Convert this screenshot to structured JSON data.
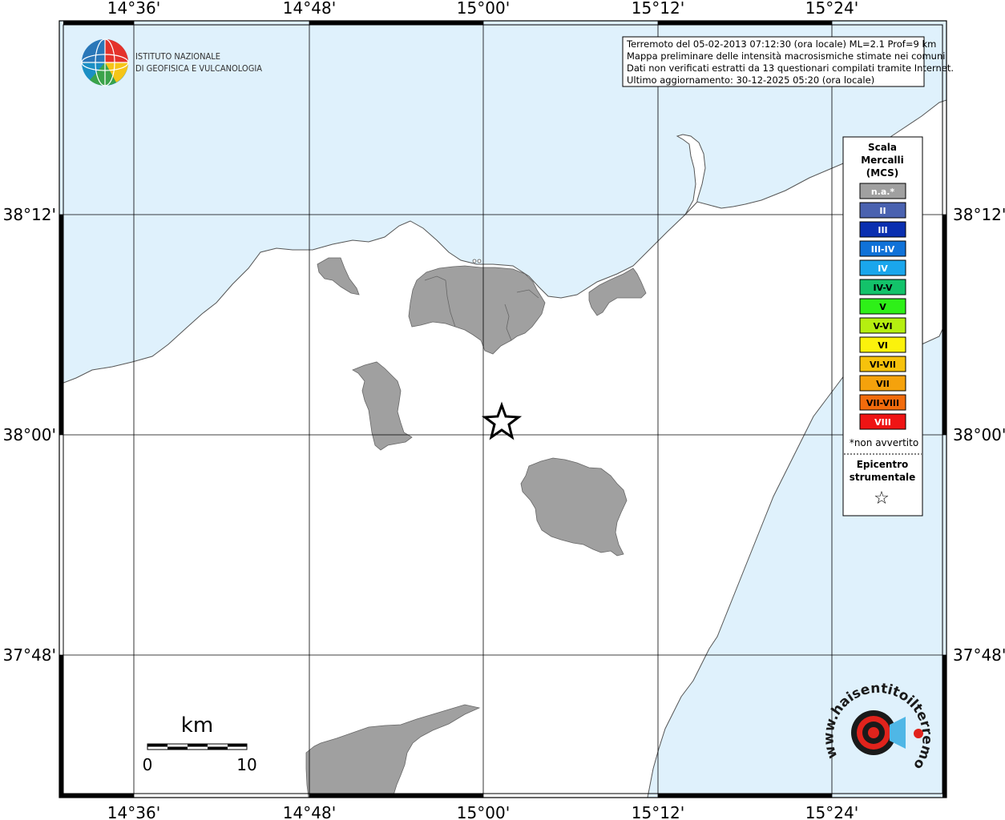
{
  "colors": {
    "sea": "#dff1fc",
    "land": "#ffffff",
    "municipality": "#a0a0a0",
    "grid": "#000000"
  },
  "axes": {
    "lon_ticks": [
      "14°36'",
      "14°48'",
      "15°00'",
      "15°12'",
      "15°24'"
    ],
    "lat_ticks": [
      "38°12'",
      "38°00'",
      "37°48'"
    ]
  },
  "logo": {
    "line1": "ISTITUTO NAZIONALE",
    "line2": "DI GEOFISICA E VULCANOLOGIA"
  },
  "info_box": {
    "line1": "Terremoto del 05-02-2013 07:12:30 (ora locale) ML=2.1 Prof=9 km",
    "line2": "Mappa preliminare delle intensità macrosismiche stimate nei comuni",
    "line3": "Dati non verificati estratti da 13 questionari compilati tramite Internet.",
    "line4": "Ultimo aggiornamento: 30-12-2025 05:20 (ora locale)"
  },
  "legend": {
    "title1": "Scala",
    "title2": "Mercalli",
    "title3": "(MCS)",
    "classes": [
      {
        "label": "n.a.*",
        "color": "#a0a0a0",
        "text_color": "#ffffff"
      },
      {
        "label": "II",
        "color": "#4a62b0",
        "text_color": "#ffffff"
      },
      {
        "label": "III",
        "color": "#0a2fb0",
        "text_color": "#ffffff"
      },
      {
        "label": "III-IV",
        "color": "#1072d8",
        "text_color": "#ffffff"
      },
      {
        "label": "IV",
        "color": "#1aa6ec",
        "text_color": "#ffffff"
      },
      {
        "label": "IV-V",
        "color": "#13c26a",
        "text_color": "#000000"
      },
      {
        "label": "V",
        "color": "#2ef018",
        "text_color": "#000000"
      },
      {
        "label": "V-VI",
        "color": "#b5ef10",
        "text_color": "#000000"
      },
      {
        "label": "VI",
        "color": "#fbf20c",
        "text_color": "#000000"
      },
      {
        "label": "VI-VII",
        "color": "#f6c20c",
        "text_color": "#000000"
      },
      {
        "label": "VII",
        "color": "#f5a20c",
        "text_color": "#000000"
      },
      {
        "label": "VII-VIII",
        "color": "#f26b0c",
        "text_color": "#000000"
      },
      {
        "label": "VIII",
        "color": "#ef1414",
        "text_color": "#ffffff"
      }
    ],
    "note": "*non avvertito",
    "epicenter_line1": "Epicentro",
    "epicenter_line2": "strumentale",
    "epicenter_symbol": "☆"
  },
  "scale_bar": {
    "unit": "km",
    "start": "0",
    "end": "10"
  },
  "watermark": {
    "text": "www.haisentitoilterremoto.it"
  }
}
